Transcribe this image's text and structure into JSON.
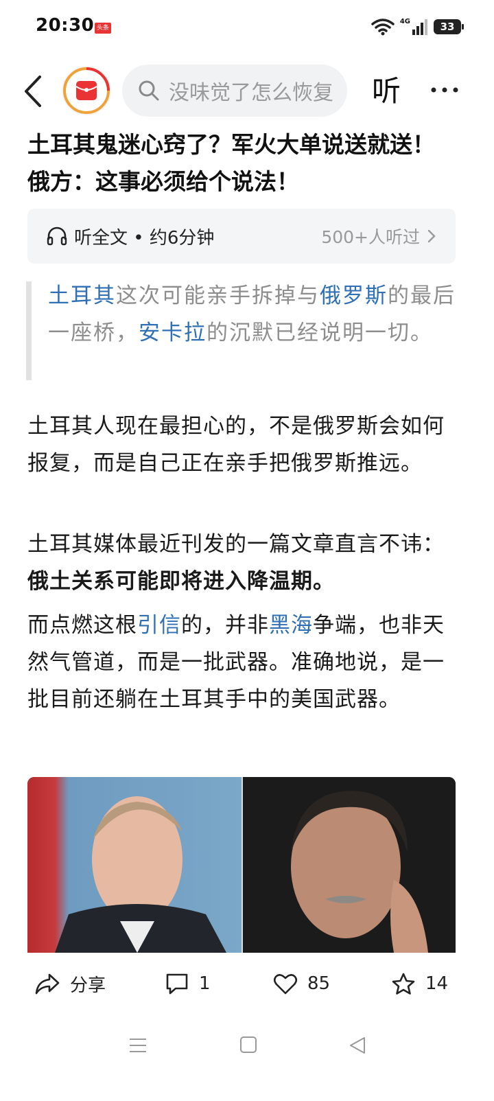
{
  "status_bar": {
    "time": "20:30",
    "app_badge": "头条",
    "network": "4G",
    "battery": "33"
  },
  "nav": {
    "search_placeholder": "没味觉了怎么恢复",
    "listen_label": "听"
  },
  "article": {
    "title": "土耳其鬼迷心窍了？军火大单说送就送！俄方：这事必须给个说法！",
    "audio": {
      "label": "听全文 • 约6分钟",
      "listeners": "500+人听过"
    },
    "quote": {
      "seg1_link": "土耳其",
      "seg2": "这次可能亲手拆掉与",
      "seg3_link": "俄罗斯",
      "seg4": "的最后一座桥，",
      "seg5_link": "安卡拉",
      "seg6": "的沉默已经说明一切。"
    },
    "p1": "土耳其人现在最担心的，不是俄罗斯会如何报复，而是自己正在亲手把俄罗斯推远。",
    "p2_normal": "土耳其媒体最近刊发的一篇文章直言不讳：",
    "p2_bold": "俄土关系可能即将进入降温期。",
    "p3": {
      "seg1": "而点燃这根",
      "seg2_link": "引信",
      "seg3": "的，并非",
      "seg4_link": "黑海",
      "seg5": "争端，也非天然气管道，而是一批武器。准确地说，是一批目前还躺在土耳其手中的美国武器。"
    }
  },
  "actions": {
    "share_label": "分享",
    "comments": "1",
    "likes": "85",
    "favorites": "14"
  },
  "colors": {
    "link": "#2e6fb5",
    "brand_red": "#e93335"
  }
}
